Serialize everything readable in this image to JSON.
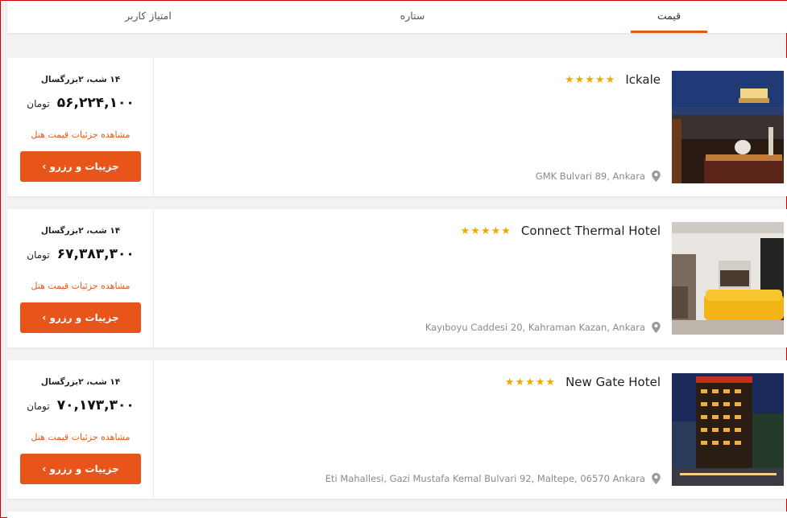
{
  "tabs": [
    {
      "label": "قیمت",
      "active": true
    },
    {
      "label": "ستاره",
      "active": false
    },
    {
      "label": "امتیاز کاربر",
      "active": false
    }
  ],
  "hotels": [
    {
      "name": "Ickale",
      "stars": "★★★★★",
      "address": "GMK Bulvari 89, Ankara",
      "nights": "۱۴ شب، ۲بزرگسال",
      "price": "۵۶,۲۲۴,۱۰۰",
      "currency": "تومان",
      "detail_link": "مشاهده جزئیات قیمت هتل",
      "button": "جزییات و رزرو  ›"
    },
    {
      "name": "Connect Thermal Hotel",
      "stars": "★★★★★",
      "address": "Kayıboyu Caddesi 20, Kahraman Kazan, Ankara",
      "nights": "۱۴ شب، ۲بزرگسال",
      "price": "۶۷,۳۸۳,۳۰۰",
      "currency": "تومان",
      "detail_link": "مشاهده جزئیات قیمت هتل",
      "button": "جزییات و رزرو  ›"
    },
    {
      "name": "New Gate Hotel",
      "stars": "★★★★★",
      "address": "Eti Mahallesi, Gazi Mustafa Kemal Bulvari 92, Maltepe, 06570 Ankara",
      "nights": "۱۴ شب، ۲بزرگسال",
      "price": "۷۰,۱۷۳,۳۰۰",
      "currency": "تومان",
      "detail_link": "مشاهده جزئیات قیمت هتل",
      "button": "جزییات و رزرو  ›"
    }
  ],
  "colors": {
    "accent": "#e8551a",
    "star": "#f5a800"
  }
}
